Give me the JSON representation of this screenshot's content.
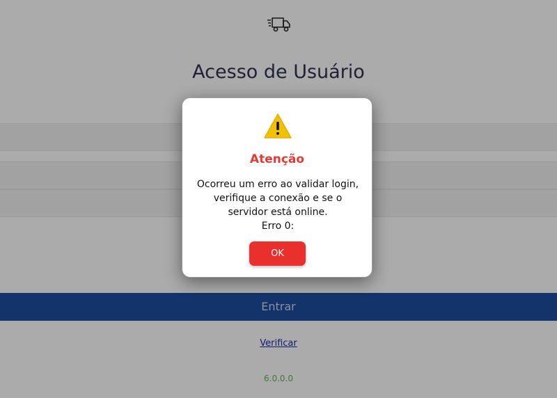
{
  "login": {
    "title": "Acesso de Usuário",
    "enter_label": "Entrar",
    "verify_label": "Verificar",
    "version": "6.0.0.0"
  },
  "dialog": {
    "title": "Atenção",
    "message_lines": [
      "Ocorreu um erro ao validar login,",
      "verifique a conexão e se o",
      "servidor está online.",
      "Erro 0:"
    ],
    "ok_label": "OK"
  },
  "icons": {
    "logo": "delivery-truck-icon",
    "warning": "warning-icon"
  },
  "colors": {
    "overlay": "rgba(0,0,0,0.33)",
    "dialog_title": "#e53b35",
    "ok_button": "#e9302c",
    "enter_button": "#1d4e9e",
    "version": "#5cb84a",
    "link": "#1b2aa6"
  }
}
